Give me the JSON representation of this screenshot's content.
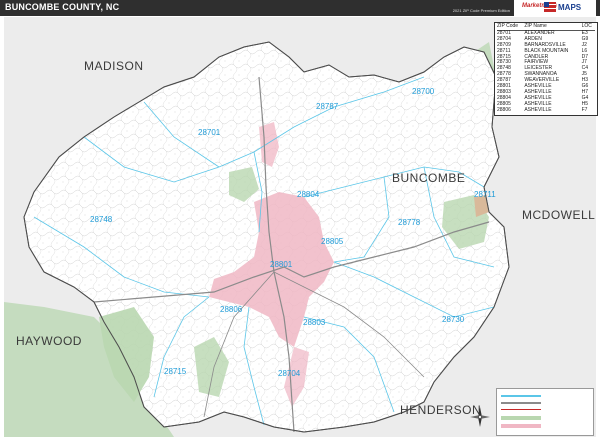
{
  "header": {
    "title": "BUNCOMBE COUNTY, NC",
    "edition": "2021 ZIP Code Premium Edition",
    "logo_text": "Marketmaps",
    "logo_brand": "MAPS"
  },
  "counties": [
    {
      "name": "MADISON"
    },
    {
      "name": "BUNCOMBE"
    },
    {
      "name": "MCDOWELL"
    },
    {
      "name": "HAYWOOD"
    },
    {
      "name": "HENDERSON"
    }
  ],
  "zip_labels": [
    {
      "code": "28787"
    },
    {
      "code": "28700"
    },
    {
      "code": "28701"
    },
    {
      "code": "28804"
    },
    {
      "code": "28711"
    },
    {
      "code": "28748"
    },
    {
      "code": "28778"
    },
    {
      "code": "28805"
    },
    {
      "code": "28801"
    },
    {
      "code": "28806"
    },
    {
      "code": "28803"
    },
    {
      "code": "28730"
    },
    {
      "code": "28715"
    },
    {
      "code": "28704"
    }
  ],
  "zip_table": {
    "headers": [
      "ZIP Code",
      "ZIP Name",
      "LOC"
    ],
    "rows": [
      [
        "28701",
        "ALEXANDER",
        "E3"
      ],
      [
        "28704",
        "ARDEN",
        "G9"
      ],
      [
        "28709",
        "BARNARDSVILLE",
        "J2"
      ],
      [
        "28711",
        "BLACK MOUNTAIN",
        "L6"
      ],
      [
        "28715",
        "CANDLER",
        "D7"
      ],
      [
        "28730",
        "FAIRVIEW",
        "J7"
      ],
      [
        "28748",
        "LEICESTER",
        "C4"
      ],
      [
        "28778",
        "SWANNANOA",
        "J5"
      ],
      [
        "28787",
        "WEAVERVILLE",
        "H3"
      ],
      [
        "28801",
        "ASHEVILLE",
        "G6"
      ],
      [
        "28803",
        "ASHEVILLE",
        "H7"
      ],
      [
        "28804",
        "ASHEVILLE",
        "G4"
      ],
      [
        "28805",
        "ASHEVILLE",
        "H5"
      ],
      [
        "28806",
        "ASHEVILLE",
        "F7"
      ]
    ]
  },
  "colors": {
    "county_fill": "#ffffff",
    "outside_fill": "#ececec",
    "forest": "#b9d7b0",
    "urban": "#f0b7c4",
    "zip_line": "#5bc6e8",
    "zip_text": "#1e9bd7",
    "roads": "#9a9a9a",
    "border": "#555555"
  },
  "icons": [
    "compass-rose-icon"
  ]
}
